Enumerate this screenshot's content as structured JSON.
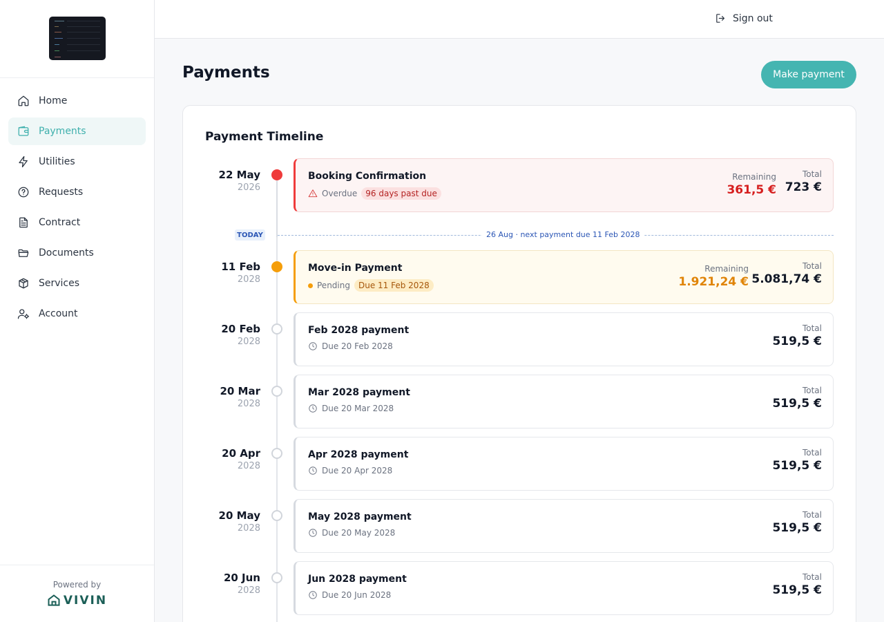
{
  "nav": {
    "items": [
      {
        "label": "Home",
        "icon": "home-icon"
      },
      {
        "label": "Payments",
        "icon": "wallet-icon"
      },
      {
        "label": "Utilities",
        "icon": "bolt-icon"
      },
      {
        "label": "Requests",
        "icon": "help-circle-icon"
      },
      {
        "label": "Contract",
        "icon": "file-text-icon"
      },
      {
        "label": "Documents",
        "icon": "folder-icon"
      },
      {
        "label": "Services",
        "icon": "box-icon"
      },
      {
        "label": "Account",
        "icon": "user-gear-icon"
      }
    ],
    "active": "Payments"
  },
  "footer": {
    "powered_by": "Powered by",
    "brand": "VIVIN"
  },
  "topbar": {
    "sign_out": "Sign out"
  },
  "page": {
    "title": "Payments",
    "make_payment": "Make payment"
  },
  "timeline": {
    "title": "Payment Timeline",
    "today": {
      "badge": "TODAY",
      "text": "26 Aug · next payment due 11 Feb 2028"
    },
    "entries": [
      {
        "day": "22 May",
        "year": "2026",
        "name": "Booking Confirmation",
        "status": "Overdue",
        "pill": "96 days past due",
        "remaining_label": "Remaining",
        "remaining": "361,5 €",
        "total_label": "Total",
        "total": "723 €"
      },
      {
        "day": "11 Feb",
        "year": "2028",
        "name": "Move-in Payment",
        "status": "Pending",
        "pill": "Due 11 Feb 2028",
        "remaining_label": "Remaining",
        "remaining": "1.921,24 €",
        "total_label": "Total",
        "total": "5.081,74 €"
      },
      {
        "day": "20 Feb",
        "year": "2028",
        "name": "Feb 2028 payment",
        "due": "Due 20 Feb 2028",
        "total_label": "Total",
        "total": "519,5 €"
      },
      {
        "day": "20 Mar",
        "year": "2028",
        "name": "Mar 2028 payment",
        "due": "Due 20 Mar 2028",
        "total_label": "Total",
        "total": "519,5 €"
      },
      {
        "day": "20 Apr",
        "year": "2028",
        "name": "Apr 2028 payment",
        "due": "Due 20 Apr 2028",
        "total_label": "Total",
        "total": "519,5 €"
      },
      {
        "day": "20 May",
        "year": "2028",
        "name": "May 2028 payment",
        "due": "Due 20 May 2028",
        "total_label": "Total",
        "total": "519,5 €"
      },
      {
        "day": "20 Jun",
        "year": "2028",
        "name": "Jun 2028 payment",
        "due": "Due 20 Jun 2028",
        "total_label": "Total",
        "total": "519,5 €"
      }
    ]
  },
  "colors": {
    "accent": "#45b5b1",
    "overdue": "#ef3b3b",
    "pending": "#f59e0b",
    "brand": "#1b5f57"
  }
}
